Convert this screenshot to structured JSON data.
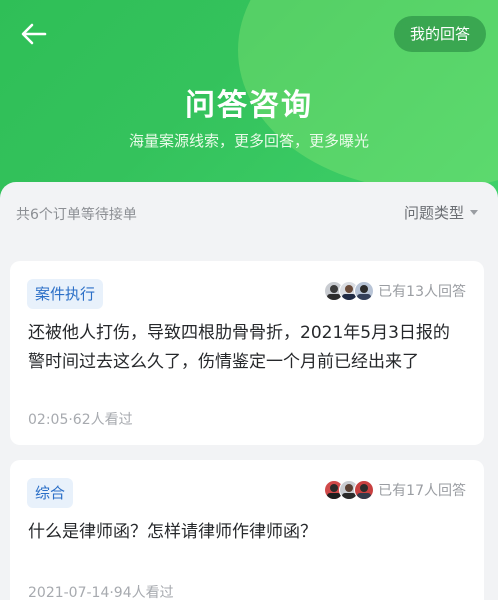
{
  "header": {
    "my_answers_label": "我的回答",
    "title": "问答咨询",
    "subtitle": "海量案源线索，更多回答，更多曝光"
  },
  "list": {
    "waiting_text": "共6个订单等待接单",
    "type_filter_label": "问题类型"
  },
  "questions": [
    {
      "tag": "案件执行",
      "answered_text": "已有13人回答",
      "text": "还被他人打伤，导致四根肋骨骨折，2021年5月3日报的警时间过去这么久了，伤情鉴定一个月前已经出来了",
      "meta": "02:05·62人看过"
    },
    {
      "tag": "综合",
      "answered_text": "已有17人回答",
      "text": "什么是律师函？怎样请律师作律师函？",
      "meta": "2021-07-14·94人看过"
    }
  ],
  "colors": {
    "brand_green": "#34c25c",
    "tag_blue": "#2b6fc7",
    "tag_bg": "#e8f1fb"
  },
  "icons": {
    "back": "arrow-left-icon",
    "caret": "caret-down-icon",
    "avatar": "lawyer-avatar-icon"
  }
}
